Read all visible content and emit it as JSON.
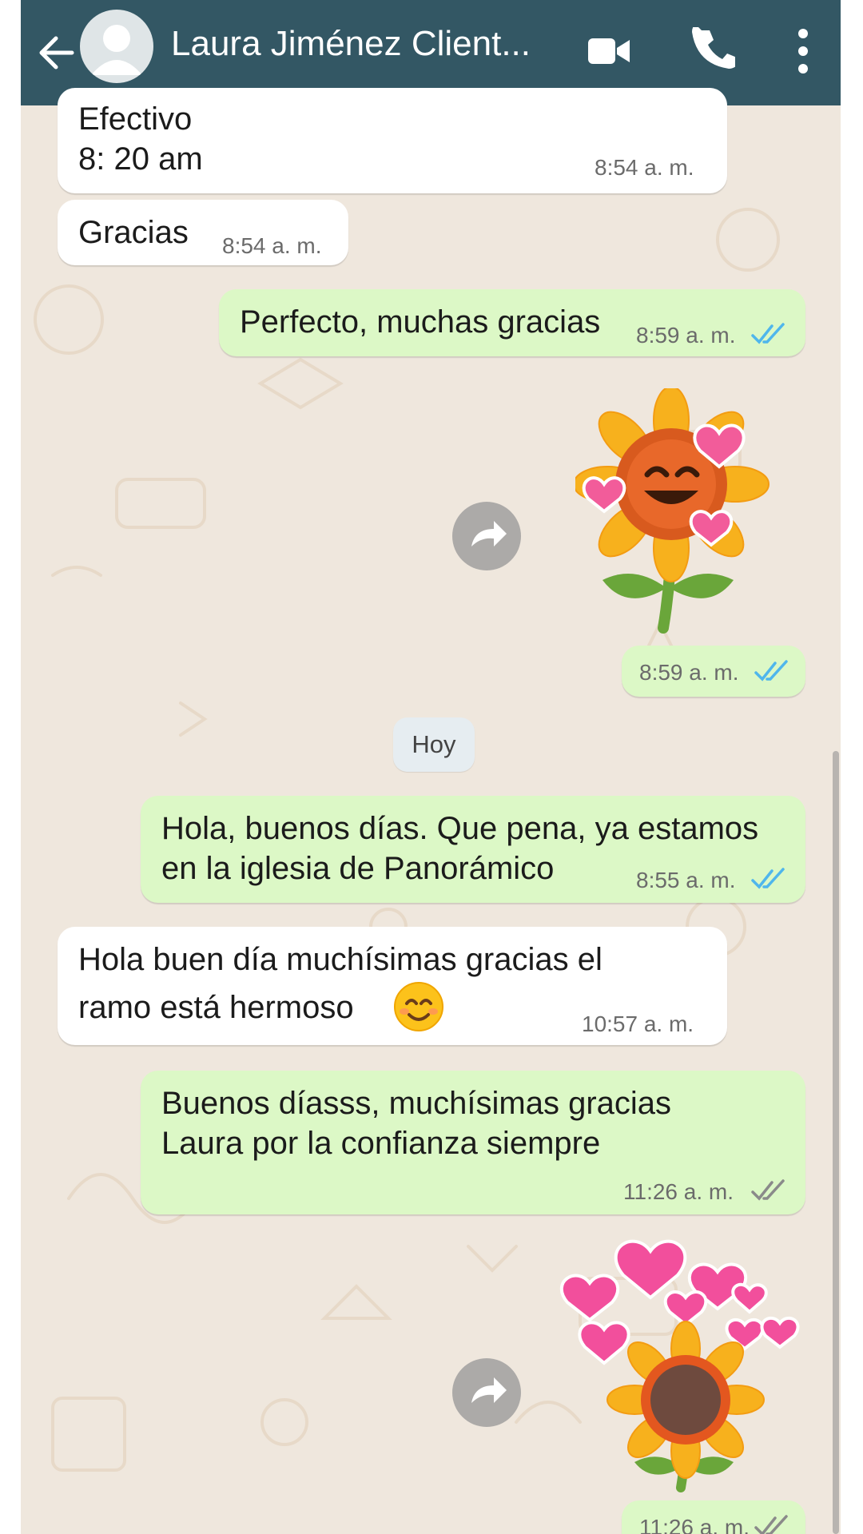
{
  "header": {
    "contact_name": "Laura Jiménez Client...",
    "icons": [
      "back-arrow-icon",
      "avatar-icon",
      "video-call-icon",
      "phone-icon",
      "more-options-icon"
    ]
  },
  "messages": [
    {
      "type": "in",
      "lines": [
        "Efectivo",
        "8: 20 am"
      ],
      "time": "8:54 a. m."
    },
    {
      "type": "in",
      "lines": [
        "Gracias"
      ],
      "time": "8:54 a. m."
    },
    {
      "type": "out",
      "lines": [
        "Perfecto, muchas gracias"
      ],
      "time": "8:59 a. m.",
      "ticks": "read"
    },
    {
      "type": "out-sticker",
      "sticker": "sunflower-hearts-sticker",
      "time": "8:59 a. m.",
      "ticks": "read"
    },
    {
      "type": "out",
      "lines": [
        "Hola, buenos días. Que pena, ya estamos",
        "en la iglesia de Panorámico"
      ],
      "time": "8:55 a. m.",
      "ticks": "read"
    },
    {
      "type": "in",
      "lines": [
        "Hola buen día muchísimas gracias el",
        "ramo está hermoso"
      ],
      "emoji": "smiling-face-icon",
      "time": "10:57 a. m."
    },
    {
      "type": "out",
      "lines": [
        "Buenos díasss, muchísimas gracias",
        "Laura por la confianza siempre"
      ],
      "time": "11:26 a. m.",
      "ticks": "delivered"
    },
    {
      "type": "out-sticker",
      "sticker": "sunflower-pink-hearts-sticker",
      "time": "11:26 a. m.",
      "ticks": "delivered"
    }
  ],
  "date_separator": "Hoy",
  "colors": {
    "header": "#335764",
    "outgoing_bubble": "#dcf8c6",
    "incoming_bubble": "#ffffff",
    "background": "#efe7dd",
    "read_ticks": "#4fb6ec",
    "delivered_ticks": "#8a8a8a"
  }
}
